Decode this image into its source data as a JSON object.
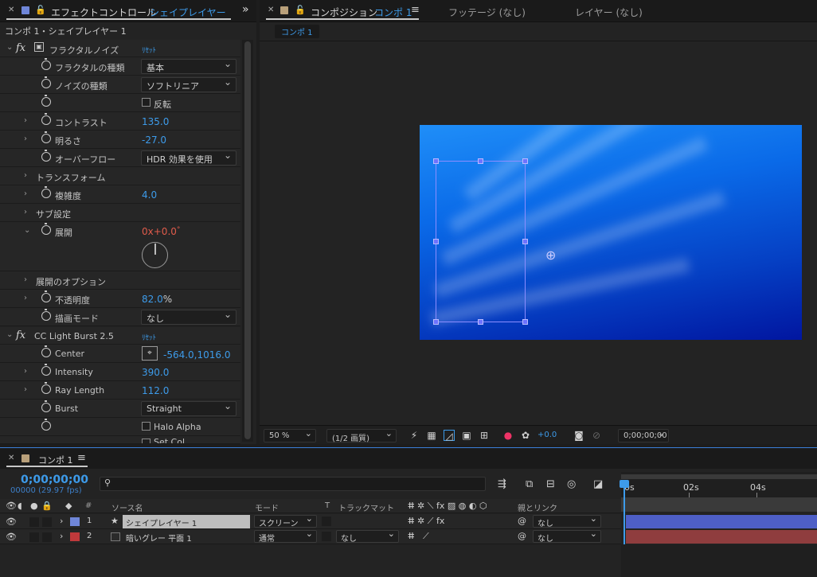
{
  "effect_controls": {
    "tab_title": "エフェクトコントロール",
    "tab_layer": "シェイプレイヤー 1",
    "subtitle": "コンポ 1・シェイプレイヤー 1",
    "fractal_noise": {
      "name": "フラクタルノイズ",
      "reset": "ﾘｾｯﾄ",
      "fractal_type_label": "フラクタルの種類",
      "fractal_type_value": "基本",
      "noise_type_label": "ノイズの種類",
      "noise_type_value": "ソフトリニア",
      "invert_label": "反転",
      "contrast_label": "コントラスト",
      "contrast_value": "135.0",
      "brightness_label": "明るさ",
      "brightness_value": "-27.0",
      "overflow_label": "オーバーフロー",
      "overflow_value": "HDR 効果を使用",
      "transform_label": "トランスフォーム",
      "complexity_label": "複雑度",
      "complexity_value": "4.0",
      "sub_settings_label": "サブ設定",
      "evolution_label": "展開",
      "evolution_value_a": "0x",
      "evolution_value_b": "+0.0",
      "evolution_value_c": "°",
      "evolution_options_label": "展開のオプション",
      "opacity_label": "不透明度",
      "opacity_value": "82.0",
      "opacity_unit": "%",
      "blend_mode_label": "描画モード",
      "blend_mode_value": "なし"
    },
    "light_burst": {
      "name": "CC Light Burst 2.5",
      "reset": "ﾘｾｯﾄ",
      "center_label": "Center",
      "center_value": "-564.0,1016.0",
      "intensity_label": "Intensity",
      "intensity_value": "390.0",
      "ray_length_label": "Ray Length",
      "ray_length_value": "112.0",
      "burst_label": "Burst",
      "burst_value": "Straight",
      "halo_alpha_label": "Halo Alpha",
      "set_color_label": "Set Col..."
    }
  },
  "composition": {
    "tab_title": "コンポジション",
    "tab_comp": "コンポ 1",
    "footage_tab": "フッテージ (なし)",
    "layer_tab": "レイヤー (なし)",
    "comp_chip": "コンポ 1",
    "zoom": "50 %",
    "resolution": "(1/2 画質)",
    "exposure": "+0.0",
    "timecode": "0;00;00;00"
  },
  "timeline": {
    "tab_title": "コンポ 1",
    "timecode": "0;00;00;00",
    "frames": "00000 (29.97 fps)",
    "search_placeholder": "",
    "ruler": [
      "0s",
      "02s",
      "04s"
    ],
    "headers": {
      "number": "#",
      "source": "ソース名",
      "mode": "モード",
      "t": "T",
      "track_matte": "トラックマット",
      "parent": "親とリンク"
    },
    "layers": [
      {
        "num": "1",
        "name": "シェイプレイヤー 1",
        "mode": "スクリーン",
        "matte": "",
        "parent": "なし",
        "label_color": "#6f86d8",
        "bar_color": "#4e5fc7"
      },
      {
        "num": "2",
        "name": "暗いグレー 平面 1",
        "mode": "通常",
        "matte": "なし",
        "parent": "なし",
        "label_color": "#c0393b",
        "bar_color": "#8f3d3e"
      }
    ]
  },
  "colors": {
    "accent": "#3d9bea",
    "keyframe_red": "#e05b4b"
  }
}
